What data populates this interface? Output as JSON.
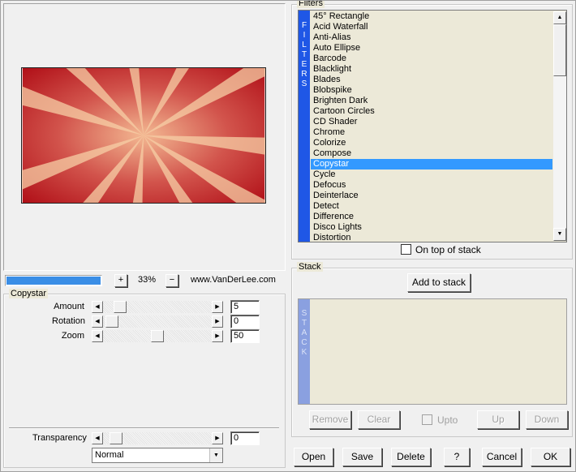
{
  "preview": {
    "gradient_colors": [
      "#b10f18",
      "#d2524a",
      "#f6c7a0"
    ]
  },
  "zoom_bar": {
    "progress_percent": 100,
    "zoom_in_label": "+",
    "zoom_value": "33%",
    "zoom_out_label": "−",
    "website": "www.VanDerLee.com"
  },
  "copystar": {
    "group_title": "Copystar",
    "params": [
      {
        "label": "Amount",
        "value": "5",
        "level": 0.05
      },
      {
        "label": "Rotation",
        "value": "0",
        "level": 0.0
      },
      {
        "label": "Zoom",
        "value": "50",
        "level": 0.5
      }
    ]
  },
  "transparency": {
    "label": "Transparency",
    "value": "0",
    "level": 0.0,
    "blend_mode": "Normal"
  },
  "filters": {
    "group_title": "Filters",
    "side_label": [
      "F",
      "I",
      "L",
      "T",
      "E",
      "R",
      "S"
    ],
    "items": [
      "45° Rectangle",
      "Acid Waterfall",
      "Anti-Alias",
      "Auto Ellipse",
      "Barcode",
      "Blacklight",
      "Blades",
      "Blobspike",
      "Brighten Dark",
      "Cartoon Circles",
      "CD Shader",
      "Chrome",
      "Colorize",
      "Compose",
      "Copystar",
      "Cycle",
      "Defocus",
      "Deinterlace",
      "Detect",
      "Difference",
      "Disco Lights",
      "Distortion"
    ],
    "selected": "Copystar",
    "on_top_label": "On top of stack",
    "on_top_checked": false
  },
  "stack": {
    "group_title": "Stack",
    "add_label": "Add to stack",
    "side_label": [
      "S",
      "T",
      "A",
      "C",
      "K"
    ],
    "remove_label": "Remove",
    "clear_label": "Clear",
    "upto_label": "Upto",
    "up_label": "Up",
    "down_label": "Down"
  },
  "footer": {
    "open": "Open",
    "save": "Save",
    "delete": "Delete",
    "help": "?",
    "cancel": "Cancel",
    "ok": "OK"
  },
  "colors": {
    "accent_blue": "#1f57e6",
    "selection": "#3399ff",
    "list_bg": "#ece9d8",
    "stack_strip": "#8aa0e0"
  }
}
